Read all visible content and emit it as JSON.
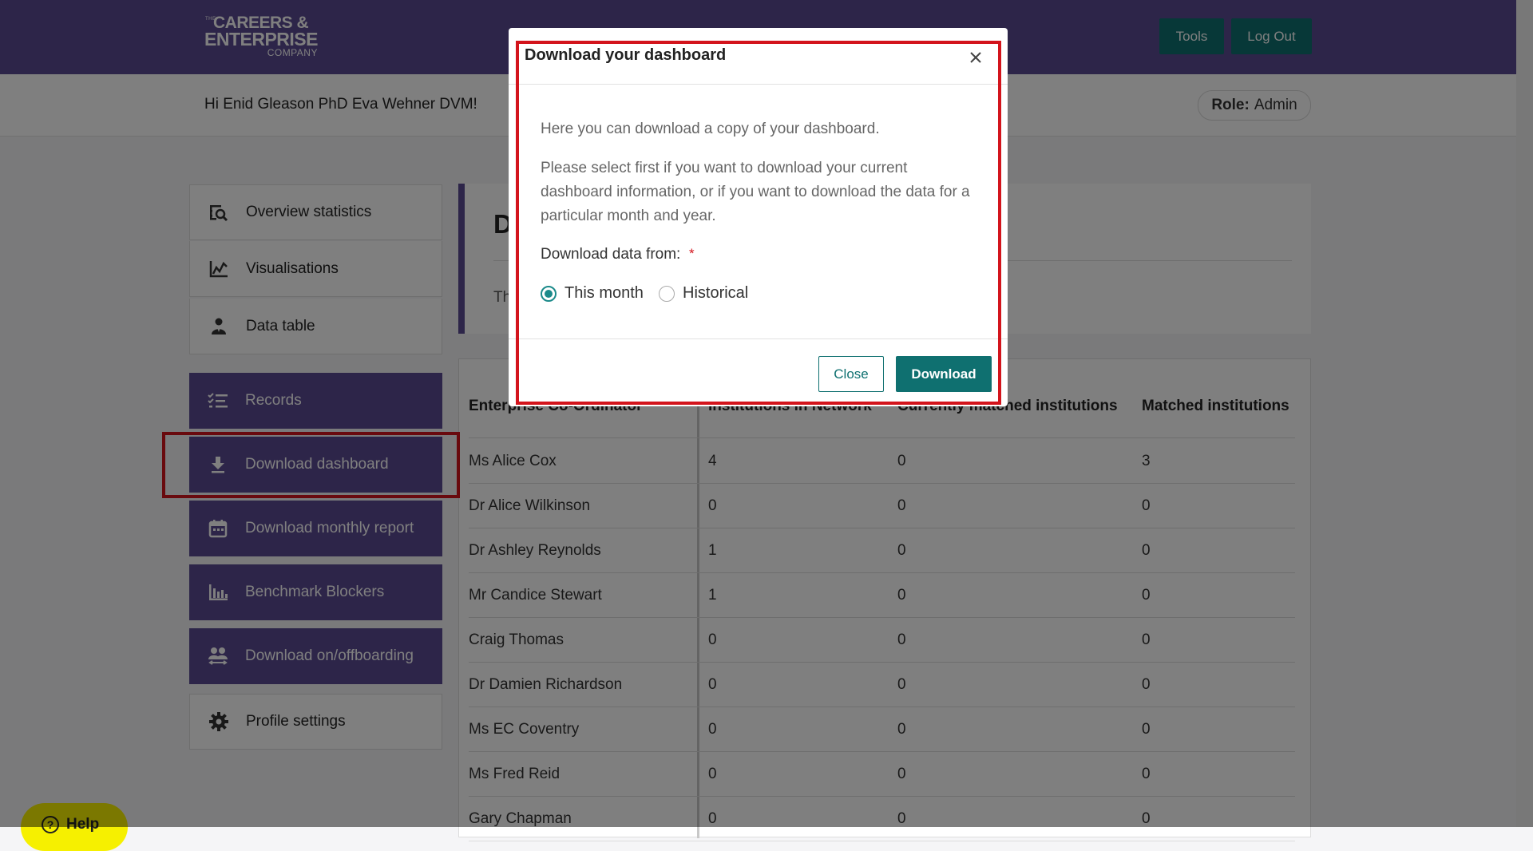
{
  "header": {
    "logo": {
      "the": "THE",
      "line1": "CAREERS &",
      "line2": "ENTERPRISE",
      "line3": "COMPANY"
    },
    "tools_label": "Tools",
    "logout_label": "Log Out"
  },
  "greeting": "Hi Enid Gleason PhD Eva Wehner DVM!",
  "role": {
    "label": "Role:",
    "value": "Admin"
  },
  "sidebar": {
    "items": [
      {
        "label": "Overview statistics",
        "icon": "overview-statistics-icon"
      },
      {
        "label": "Visualisations",
        "icon": "chart-icon"
      },
      {
        "label": "Data table",
        "icon": "person-icon"
      },
      {
        "label": "Records",
        "icon": "checklist-icon"
      },
      {
        "label": "Download dashboard",
        "icon": "download-icon"
      },
      {
        "label": "Download monthly report",
        "icon": "calendar-icon"
      },
      {
        "label": "Benchmark Blockers",
        "icon": "bar-chart-icon"
      },
      {
        "label": "Download on/offboarding",
        "icon": "people-icon"
      },
      {
        "label": "Profile settings",
        "icon": "gear-icon"
      }
    ]
  },
  "page": {
    "title": "Da",
    "description": "The"
  },
  "table": {
    "headers": [
      "Enterprise Co-Ordinator",
      "Institutions in Network",
      "Currently matched institutions",
      "Matched institutions"
    ],
    "rows": [
      [
        "Ms Alice Cox",
        "4",
        "0",
        "3"
      ],
      [
        "Dr Alice Wilkinson",
        "0",
        "0",
        "0"
      ],
      [
        "Dr Ashley Reynolds",
        "1",
        "0",
        "0"
      ],
      [
        "Mr Candice Stewart",
        "1",
        "0",
        "0"
      ],
      [
        "Craig Thomas",
        "0",
        "0",
        "0"
      ],
      [
        "Dr Damien Richardson",
        "0",
        "0",
        "0"
      ],
      [
        "Ms EC Coventry",
        "0",
        "0",
        "0"
      ],
      [
        "Ms Fred Reid",
        "0",
        "0",
        "0"
      ],
      [
        "Gary Chapman",
        "0",
        "0",
        "0"
      ]
    ]
  },
  "modal": {
    "title": "Download your dashboard",
    "intro": "Here you can download a copy of your dashboard.",
    "instructions": "Please select first if you want to download your current dashboard information, or if you want to download the data for a particular month and year.",
    "field_label": "Download data from:",
    "required_mark": "*",
    "options": [
      {
        "label": "This month",
        "selected": true
      },
      {
        "label": "Historical",
        "selected": false
      }
    ],
    "close_label": "Close",
    "download_label": "Download"
  },
  "help_label": "Help",
  "colors": {
    "brand_purple": "#5b4a92",
    "teal": "#0f7070",
    "highlight_red": "#d3141c",
    "help_yellow": "#f6f000"
  }
}
